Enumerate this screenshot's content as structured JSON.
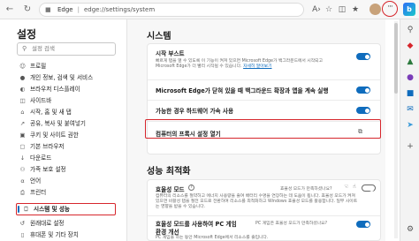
{
  "browser": {
    "url_site": "Edge",
    "url_path": "edge://settings/system"
  },
  "sidebar": {
    "title": "설정",
    "search_placeholder": "설정 검색",
    "items": [
      {
        "label": "프로필",
        "icon": "person-icon"
      },
      {
        "label": "개인 정보, 검색 및 서비스",
        "icon": "lock-icon"
      },
      {
        "label": "브라우저 디스플레이",
        "icon": "appearance-icon"
      },
      {
        "label": "사이드바",
        "icon": "sidebar-icon"
      },
      {
        "label": "시작, 홈 및 새 탭",
        "icon": "home-icon"
      },
      {
        "label": "공유, 복사 및 붙여넣기",
        "icon": "share-icon"
      },
      {
        "label": "쿠키 및 사이트 권한",
        "icon": "cookie-icon"
      },
      {
        "label": "기본 브라우저",
        "icon": "browser-icon"
      },
      {
        "label": "다운로드",
        "icon": "download-icon"
      },
      {
        "label": "가족 보호 설정",
        "icon": "family-icon"
      },
      {
        "label": "언어",
        "icon": "language-icon"
      },
      {
        "label": "프린터",
        "icon": "printer-icon"
      },
      {
        "label": "시스템 및 성능",
        "icon": "system-icon"
      },
      {
        "label": "원래대로 설정",
        "icon": "reset-icon"
      },
      {
        "label": "휴대폰 및 기타 장치",
        "icon": "phone-icon"
      }
    ]
  },
  "main": {
    "system_title": "시스템",
    "startup_boost": {
      "title": "시작 부스트",
      "desc": "빠르게 탭을 열 수 있도록 이 기능이 켜져 있으면 Microsoft Edge가 백그라운드에서 시작되고 Microsoft Edge가 더 빨리 시작될 수 있습니다.",
      "link": "자세히 알아보기"
    },
    "bg_extensions": {
      "title": "Microsoft Edge가 닫혀 있을 때 백그라운드 확장과 앱을 계속 실행"
    },
    "hw_accel": {
      "title": "가능한 경우 하드웨어 가속 사용"
    },
    "proxy": {
      "title": "컴퓨터의 프록시 설정 열기"
    },
    "perf_title": "성능 최적화",
    "efficiency": {
      "title": "효율성 모드",
      "note": "효율성 모드가 만족하셨나요?",
      "desc": "컴퓨터의 리소스를 절약하고 에너지 사용량을 줄여 배터리 수명을 연장하는 데 도움이 됩니다. 효율성 모드가 켜져 있으면 비활성 탭을 절전 모드로 전환하여 리소스를 최적화하고 Windows 효율성 모드를 활용합니다. 일부 사이트는 영향을 받을 수 있습니다."
    },
    "gaming": {
      "title": "효율성 모드를 사용하여 PC 게임",
      "title2": "환경 개선",
      "note": "PC 게임은 효율성 모드가 만족하셨나요?",
      "desc": "PC 게임을 하는 동안 Microsoft Edge에서 리소스를 줄입니다."
    }
  },
  "colors": {
    "accent": "#0f6cbd",
    "highlight": "#d6262c"
  }
}
